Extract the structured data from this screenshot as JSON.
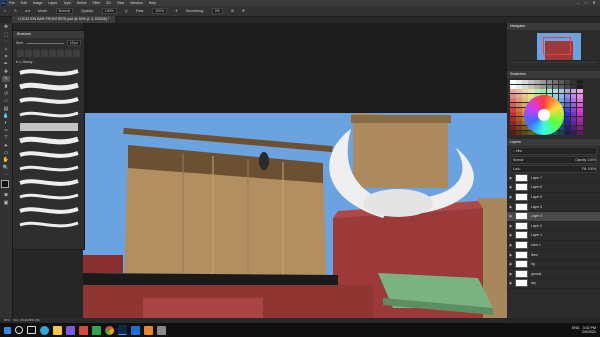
{
  "menu": {
    "items": [
      "File",
      "Edit",
      "Image",
      "Layer",
      "Type",
      "Select",
      "Filter",
      "3D",
      "View",
      "Window",
      "Help"
    ]
  },
  "options_bar": {
    "mode_label": "Mode:",
    "mode_value": "Normal",
    "opacity_label": "Opacity:",
    "opacity_value": "100%",
    "flow_label": "Flow:",
    "flow_value": "100%",
    "smoothing_label": "Smoothing:",
    "smoothing_value": "0%"
  },
  "document": {
    "tab_title": "LOCATION BAR FRONTIERS.psd @ 50% (L 3, RGB/8) *",
    "status_zoom": "50%",
    "status_doc": "Doc: 26.4M/394.3M"
  },
  "brushes_panel": {
    "title": "Brushes",
    "size_label": "Size:",
    "size_value": "19 px",
    "group_label": "Sunny"
  },
  "navigator_panel": {
    "title": "Navigator"
  },
  "swatches_panel": {
    "title": "Swatches"
  },
  "layers_panel": {
    "title": "Layers",
    "filter_label": "Kind",
    "blend_mode": "Normal",
    "opacity_label": "Opacity:",
    "opacity_value": "100%",
    "lock_label": "Lock:",
    "fill_label": "Fill:",
    "fill_value": "100%",
    "layers": [
      {
        "name": "Layer 7",
        "selected": false
      },
      {
        "name": "Layer 6",
        "selected": false
      },
      {
        "name": "Layer 5",
        "selected": false
      },
      {
        "name": "Layer 4",
        "selected": false
      },
      {
        "name": "Layer 3",
        "selected": true
      },
      {
        "name": "Layer 2",
        "selected": false
      },
      {
        "name": "Layer 1",
        "selected": false
      },
      {
        "name": "color 1",
        "selected": false
      },
      {
        "name": "lines",
        "selected": false
      },
      {
        "name": "bg",
        "selected": false
      },
      {
        "name": "ground",
        "selected": false
      },
      {
        "name": "sky",
        "selected": false
      }
    ]
  },
  "taskbar": {
    "time": "3:02 PM",
    "date": "2/9/2021",
    "lang": "ENG"
  },
  "colors": {
    "sky": "#6aa3df",
    "wood": "#a8875c",
    "roof_red": "#9b3a38",
    "awning_green": "#7ab37f",
    "horn": "#f3f3f3"
  }
}
